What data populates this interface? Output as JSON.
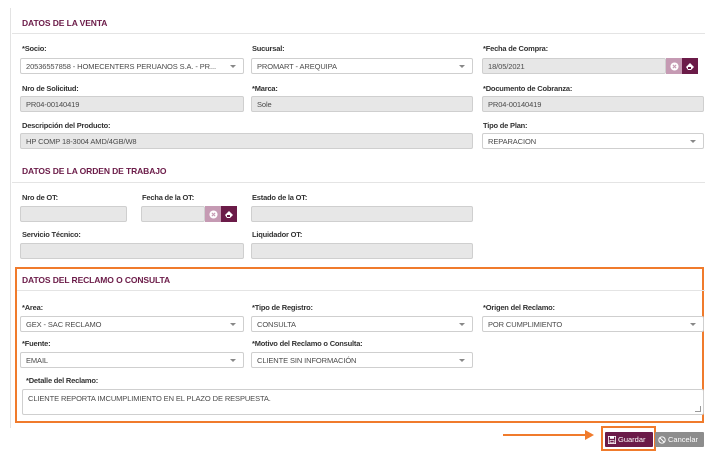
{
  "venta": {
    "title": "DATOS DE LA VENTA",
    "socio_label": "*Socio:",
    "socio_value": "20536557858 - HOMECENTERS PERUANOS S.A. - PR...",
    "sucursal_label": "Sucursal:",
    "sucursal_value": "PROMART - AREQUIPA",
    "fecha_compra_label": "*Fecha de Compra:",
    "fecha_compra_value": "18/05/2021",
    "nro_solicitud_label": "Nro de Solicitud:",
    "nro_solicitud_value": "PR04-00140419",
    "marca_label": "*Marca:",
    "marca_value": "Sole",
    "doc_cobranza_label": "*Documento de Cobranza:",
    "doc_cobranza_value": "PR04-00140419",
    "descripcion_label": "Descripción del Producto:",
    "descripcion_value": "HP COMP 18-3004 AMD/4GB/W8",
    "tipo_plan_label": "Tipo de Plan:",
    "tipo_plan_value": "REPARACION"
  },
  "orden": {
    "title": "DATOS DE LA ORDEN DE TRABAJO",
    "nro_ot_label": "Nro de OT:",
    "nro_ot_value": "",
    "fecha_ot_label": "Fecha de la OT:",
    "fecha_ot_value": "",
    "estado_ot_label": "Estado de la OT:",
    "estado_ot_value": "",
    "servicio_label": "Servicio Técnico:",
    "servicio_value": "",
    "liquidador_label": "Liquidador OT:",
    "liquidador_value": ""
  },
  "reclamo": {
    "title": "DATOS DEL RECLAMO O CONSULTA",
    "area_label": "*Area:",
    "area_value": "GEX - SAC RECLAMO",
    "tipo_registro_label": "*Tipo de Registro:",
    "tipo_registro_value": "CONSULTA",
    "origen_label": "*Origen del Reclamo:",
    "origen_value": "POR CUMPLIMIENTO",
    "fuente_label": "*Fuente:",
    "fuente_value": "EMAIL",
    "motivo_label": "*Motivo del Reclamo o Consulta:",
    "motivo_value": "CLIENTE SIN INFORMACIÓN",
    "detalle_label": "*Detalle del Reclamo:",
    "detalle_value": "CLIENTE REPORTA IMCUMPLIMIENTO EN EL PLAZO DE RESPUESTA."
  },
  "actions": {
    "save_label": "Guardar",
    "cancel_label": "Cancelar"
  },
  "colors": {
    "accent": "#6b1b48",
    "highlight": "#f07b2c",
    "readonly_bg": "#e7e7e7",
    "cancel_bg": "#8d8d8d"
  },
  "icons": {
    "date_clear": "x-circle-icon",
    "date_calendar": "eraser-icon",
    "save": "save-icon",
    "cancel": "ban-icon"
  }
}
